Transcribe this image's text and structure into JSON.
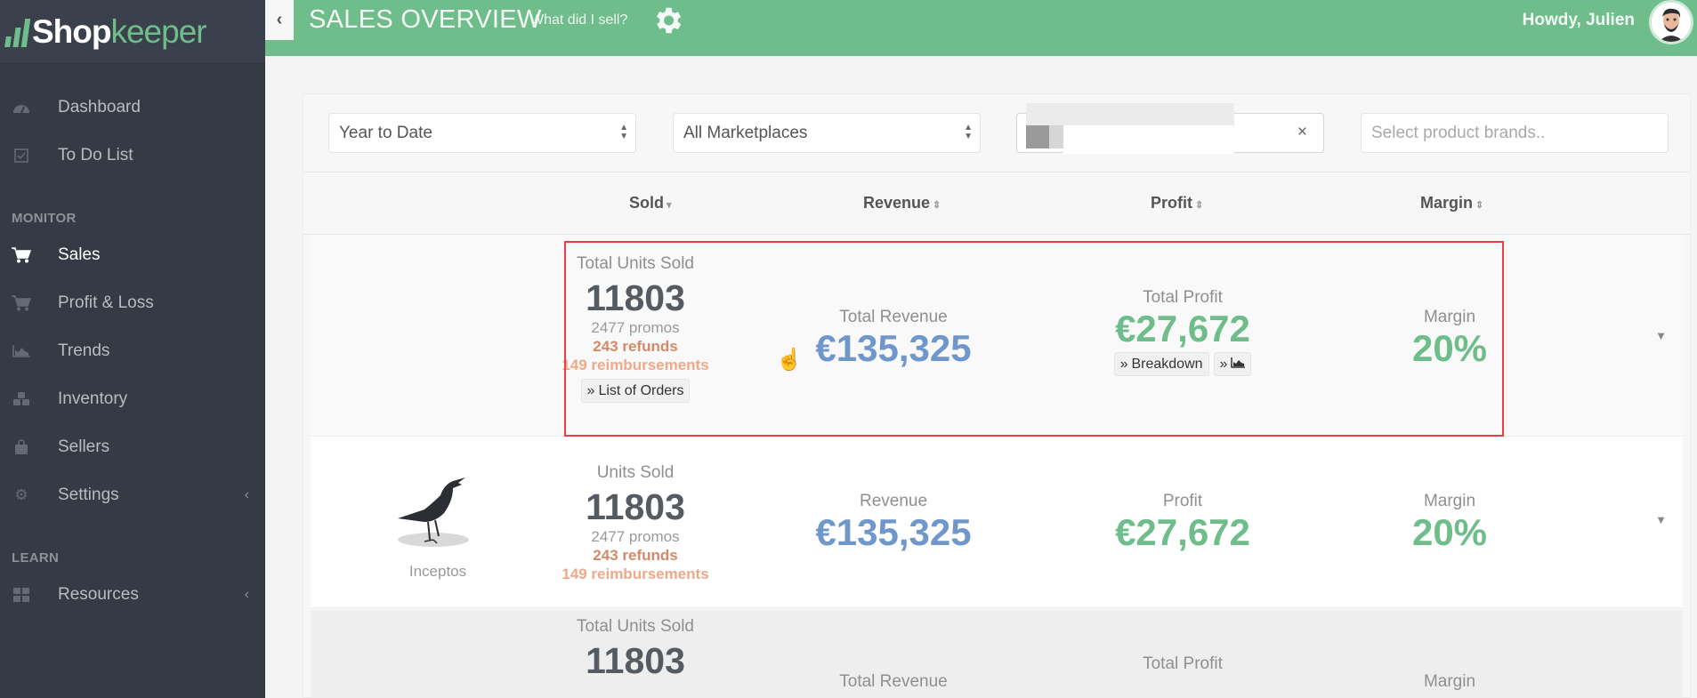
{
  "sidebar": {
    "logo": {
      "part1": "Shop",
      "part2": "keeper"
    },
    "items": [
      {
        "label": "Dashboard",
        "icon": "dashboard-icon"
      },
      {
        "label": "To Do List",
        "icon": "checkbox-icon"
      }
    ],
    "sections": [
      {
        "title": "MONITOR",
        "items": [
          {
            "label": "Sales",
            "icon": "cart-icon",
            "active": true
          },
          {
            "label": "Profit & Loss",
            "icon": "cart-icon"
          },
          {
            "label": "Trends",
            "icon": "area-chart-icon"
          },
          {
            "label": "Inventory",
            "icon": "cubes-icon"
          },
          {
            "label": "Sellers",
            "icon": "shopping-bag-icon"
          },
          {
            "label": "Settings",
            "icon": "gear-icon",
            "has_submenu": true
          }
        ]
      },
      {
        "title": "LEARN",
        "items": [
          {
            "label": "Resources",
            "icon": "grid-icon",
            "has_submenu": true
          }
        ]
      }
    ]
  },
  "header": {
    "back_icon": "chevron-left-icon",
    "title": "SALES OVERVIEW",
    "subtitle": "What did I sell?",
    "settings_icon": "gear-icon",
    "greeting": "Howdy, Julien",
    "accent_color": "#6ebd8a"
  },
  "filters": {
    "period": {
      "value": "Year to Date"
    },
    "marketplace": {
      "value": "All Marketplaces"
    },
    "product": {
      "value": "",
      "clear_label": "×"
    },
    "brands": {
      "placeholder": "Select product brands.."
    }
  },
  "columns": [
    {
      "label": "Sold",
      "sort": "▾"
    },
    {
      "label": "Revenue",
      "sort": "⇕"
    },
    {
      "label": "Profit",
      "sort": "⇕"
    },
    {
      "label": "Margin",
      "sort": "⇕"
    }
  ],
  "totals": {
    "units_label": "Total Units Sold",
    "units": "11803",
    "promos": "2477 promos",
    "refunds": "243 refunds",
    "reimbursements": "149 reimbursements",
    "orders_button": "List of Orders",
    "revenue_label": "Total Revenue",
    "revenue": "€135,325",
    "profit_label": "Total Profit",
    "profit": "€27,672",
    "breakdown_button": "Breakdown",
    "margin_label": "Margin",
    "margin": "20%"
  },
  "products": [
    {
      "brand": "Inceptos",
      "units_label": "Units Sold",
      "units": "11803",
      "promos": "2477 promos",
      "refunds": "243 refunds",
      "reimbursements": "149 reimbursements",
      "revenue_label": "Revenue",
      "revenue": "€135,325",
      "profit_label": "Profit",
      "profit": "€27,672",
      "margin_label": "Margin",
      "margin": "20%"
    }
  ],
  "third_row": {
    "units_label": "Total Units Sold",
    "units": "11803",
    "revenue_label": "Total Revenue",
    "profit_label": "Total Profit",
    "margin_label": "Margin"
  },
  "colors": {
    "revenue": "#6f97cc",
    "profit": "#6ebd8a",
    "refunds": "#d48a6a",
    "reimbursements": "#f0a88a",
    "highlight": "#ee3b45"
  }
}
